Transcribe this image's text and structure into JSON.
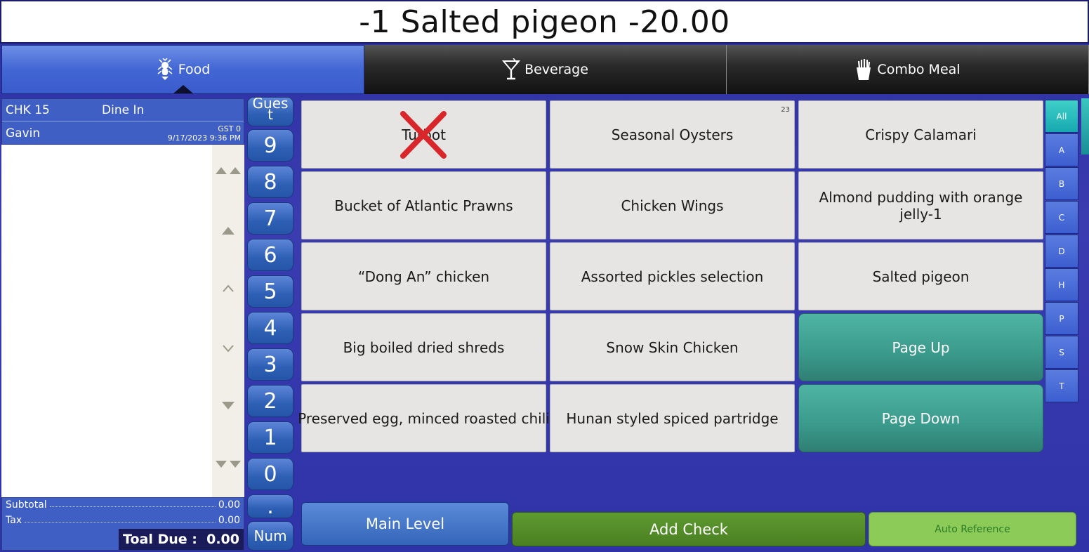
{
  "status_line": "-1 Salted pigeon -20.00",
  "tabs": [
    {
      "label": "Food",
      "icon": "lobster-icon",
      "active": true
    },
    {
      "label": "Beverage",
      "icon": "cocktail-icon",
      "active": false
    },
    {
      "label": "Combo Meal",
      "icon": "fries-icon",
      "active": false
    }
  ],
  "check": {
    "number": "CHK 15",
    "order_type": "Dine In",
    "server": "Gavin",
    "guests": "GST 0",
    "datetime": "9/17/2023 9:36 PM",
    "subtotal_label": "Subtotal",
    "subtotal": "0.00",
    "tax_label": "Tax",
    "tax": "0.00",
    "total_due": "Toal Due :  0.00"
  },
  "numpad": [
    "Gues\nt",
    "9",
    "8",
    "7",
    "6",
    "5",
    "4",
    "3",
    "2",
    "1",
    "0",
    ".",
    "Num"
  ],
  "menu_items": [
    {
      "label": "Turbot",
      "unavailable": true
    },
    {
      "label": "Seasonal Oysters",
      "count": "23"
    },
    {
      "label": "Crispy Calamari"
    },
    {
      "label": "Bucket of Atlantic Prawns"
    },
    {
      "label": "Chicken Wings"
    },
    {
      "label": "Almond pudding with orange jelly-1"
    },
    {
      "label": "“Dong An” chicken"
    },
    {
      "label": "Assorted pickles selection"
    },
    {
      "label": "Salted pigeon"
    },
    {
      "label": "Big boiled dried shreds"
    },
    {
      "label": "Snow Skin Chicken"
    },
    {
      "label": "Page Up"
    },
    {
      "label": "Preserved egg, minced roasted chili"
    },
    {
      "label": "Hunan styled spiced partridge"
    },
    {
      "label": "Page Down"
    }
  ],
  "alpha_index": [
    "All",
    "A",
    "B",
    "C",
    "D",
    "H",
    "P",
    "S",
    "T"
  ],
  "buttons": {
    "main_level": "Main Level",
    "add_check": "Add Check",
    "auto_reference": "Auto Reference"
  },
  "colors": {
    "active_tab": "#4266d4",
    "nav_button": "#3a9a8c",
    "add_check": "#4a8022",
    "unavailable_mark": "#d9262a"
  }
}
